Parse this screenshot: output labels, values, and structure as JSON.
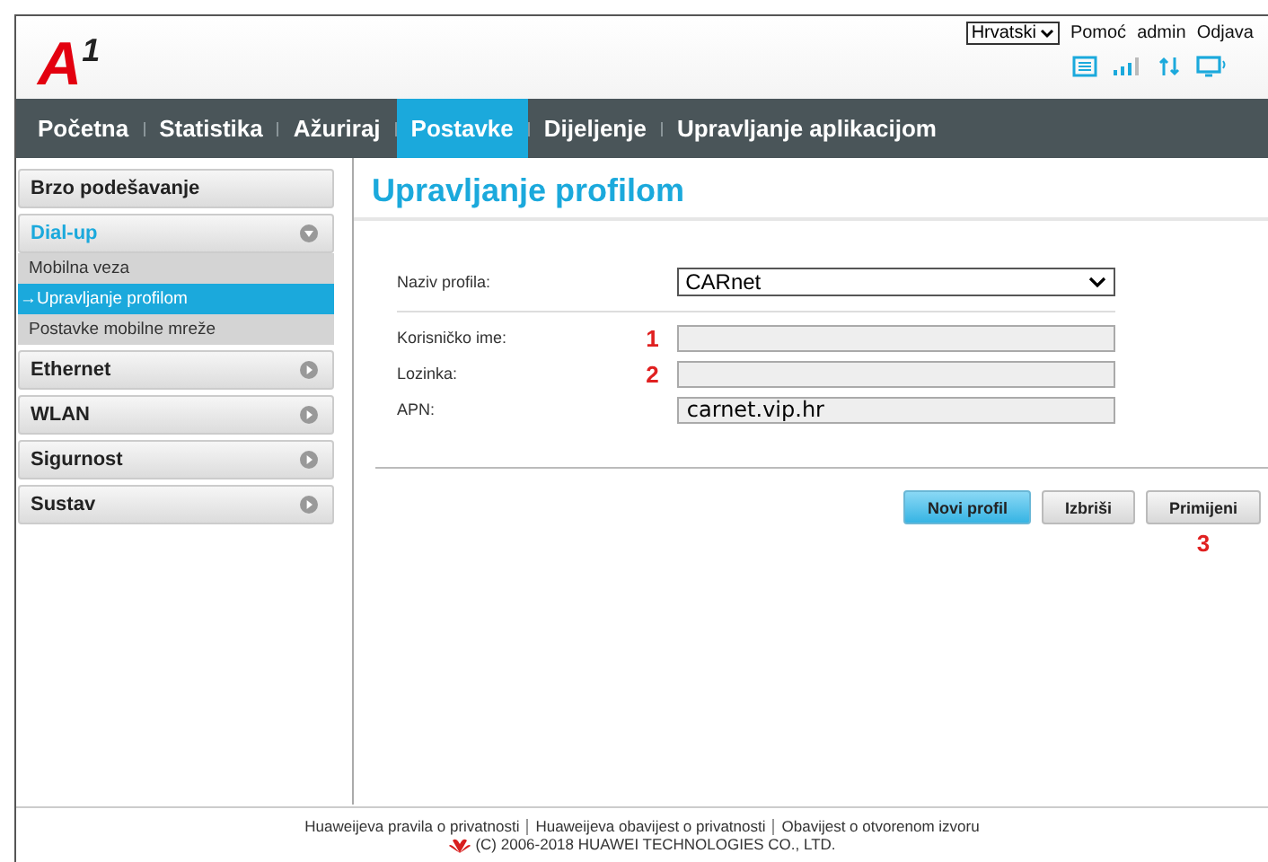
{
  "header": {
    "logo": "A",
    "logo_sup": "1",
    "language": "Hrvatski",
    "links": [
      "Pomoć",
      "admin",
      "Odjava"
    ]
  },
  "nav": [
    {
      "label": "Početna",
      "selected": false
    },
    {
      "label": "Statistika",
      "selected": false
    },
    {
      "label": "Ažuriraj",
      "selected": false
    },
    {
      "label": "Postavke",
      "selected": true
    },
    {
      "label": "Dijeljenje",
      "selected": false
    },
    {
      "label": "Upravljanje aplikacijom",
      "selected": false
    }
  ],
  "sidebar": [
    {
      "label": "Brzo podešavanje",
      "kind": "link"
    },
    {
      "label": "Dial-up",
      "kind": "group",
      "expanded": true,
      "children": [
        {
          "label": "Mobilna veza",
          "selected": false
        },
        {
          "label": "Upravljanje profilom",
          "selected": true,
          "arrow": "→"
        },
        {
          "label": "Postavke mobilne mreže",
          "selected": false
        }
      ]
    },
    {
      "label": "Ethernet",
      "kind": "group",
      "expanded": false
    },
    {
      "label": "WLAN",
      "kind": "group",
      "expanded": false
    },
    {
      "label": "Sigurnost",
      "kind": "group",
      "expanded": false
    },
    {
      "label": "Sustav",
      "kind": "group",
      "expanded": false
    }
  ],
  "page_title": "Upravljanje profilom",
  "profile": {
    "label": "Naziv profila:",
    "value": "CARnet"
  },
  "fields": [
    {
      "label": "Korisničko ime:",
      "marker": "1"
    },
    {
      "label": "Lozinka:",
      "marker": "2"
    },
    {
      "label": "APN:",
      "value": "carnet.vip.hr"
    }
  ],
  "buttons": [
    {
      "label": "Novi profil",
      "primary": true
    },
    {
      "label": "Izbriši",
      "primary": false
    },
    {
      "label": "Primijeni",
      "primary": false,
      "marker": "3"
    }
  ],
  "footer": {
    "links": [
      "Huaweijeva pravila o privatnosti",
      "Huaweijeva obavijest o privatnosti",
      "Obavijest o otvorenom izvoru"
    ],
    "copyright": "(C) 2006-2018 HUAWEI TECHNOLOGIES CO., LTD."
  }
}
